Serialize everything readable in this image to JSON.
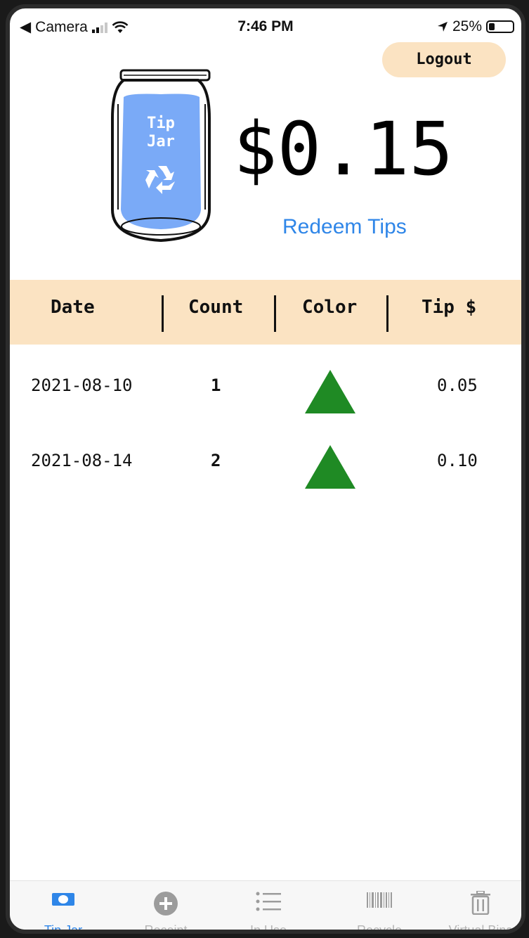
{
  "status_bar": {
    "back_label": "Camera",
    "time": "7:46 PM",
    "battery": "25%"
  },
  "header": {
    "logout_label": "Logout",
    "jar_label_line1": "Tip",
    "jar_label_line2": "Jar",
    "balance": "$0.15",
    "redeem_label": "Redeem Tips"
  },
  "table": {
    "columns": [
      "Date",
      "Count",
      "Color",
      "Tip $"
    ],
    "rows": [
      {
        "date": "2021-08-10",
        "count": "1",
        "color": "green",
        "tip": "0.05"
      },
      {
        "date": "2021-08-14",
        "count": "2",
        "color": "green",
        "tip": "0.10"
      }
    ]
  },
  "tabs": [
    {
      "label": "Tip Jar",
      "icon": "money-icon",
      "active": true
    },
    {
      "label": "Receipt",
      "icon": "plus-circle-icon",
      "active": false
    },
    {
      "label": "In Use",
      "icon": "list-icon",
      "active": false
    },
    {
      "label": "Recycle",
      "icon": "barcode-icon",
      "active": false
    },
    {
      "label": "Virtual Bins",
      "icon": "trash-icon",
      "active": false
    }
  ],
  "colors": {
    "accent": "#2f86e8",
    "header_bg": "#fbe3c2",
    "triangle": "#1f8a24",
    "jar_label": "#7aaaf7"
  }
}
